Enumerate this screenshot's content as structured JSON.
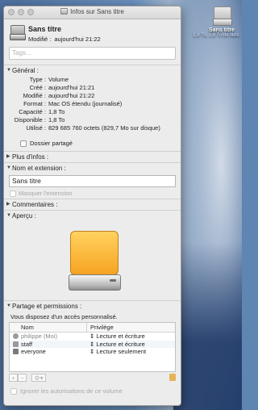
{
  "window_title": "Infos sur Sans titre",
  "desktop_icon": {
    "name": "Sans titre",
    "sub": "1,8 To, 1,8 To de libre"
  },
  "header": {
    "name": "Sans titre",
    "modified_label": "Modifié :",
    "modified_value": "aujourd'hui 21:22"
  },
  "tags_placeholder": "Tags...",
  "sections": {
    "general": "Général :",
    "more_info": "Plus d'infos :",
    "name_ext": "Nom et extension :",
    "comments": "Commentaires :",
    "preview": "Aperçu :",
    "sharing": "Partage et permissions :"
  },
  "general_rows": [
    {
      "label": "Type :",
      "value": "Volume"
    },
    {
      "label": "Créé :",
      "value": "aujourd'hui 21:21"
    },
    {
      "label": "Modifié :",
      "value": "aujourd'hui 21:22"
    },
    {
      "label": "Format :",
      "value": "Mac OS étendu (journalisé)"
    },
    {
      "label": "Capacité :",
      "value": "1,8 To"
    },
    {
      "label": "Disponible :",
      "value": "1,8 To"
    },
    {
      "label": "Utilisé :",
      "value": "829 685 760 octets (829,7 Mo sur disque)"
    }
  ],
  "shared_folder_label": "Dossier partagé",
  "name_field_value": "Sans titre",
  "hide_extension_label": "Masquer l'extension",
  "access_text": "Vous disposez d'un accès personnalisé.",
  "table": {
    "headers": [
      "Nom",
      "Privilège"
    ],
    "rows": [
      {
        "name": "philippe (Moi)",
        "priv": "Lecture et écriture"
      },
      {
        "name": "staff",
        "priv": "Lecture et écriture"
      },
      {
        "name": "everyone",
        "priv": "Lecture seulement"
      }
    ]
  },
  "buttons": {
    "add": "+",
    "remove": "−",
    "gear": "⚙▾"
  },
  "ignore_label": "Ignorer les autorisations de ce volume"
}
